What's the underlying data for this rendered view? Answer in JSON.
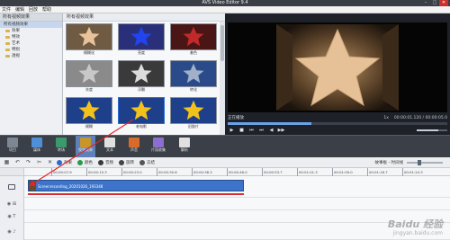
{
  "app": {
    "title": "AVS Video Editor 9.4",
    "window_controls": [
      "–",
      "□",
      "✕"
    ]
  },
  "menu": [
    "文件",
    "编辑",
    "回放",
    "帮助"
  ],
  "sidebar": {
    "header": "所有视频效果",
    "items": [
      {
        "label": "所有视频效果",
        "selected": true
      },
      {
        "label": "效果",
        "selected": false
      },
      {
        "label": "特效",
        "selected": false
      },
      {
        "label": "艺术",
        "selected": false
      },
      {
        "label": "特别",
        "selected": false
      },
      {
        "label": "透视",
        "selected": false
      }
    ]
  },
  "gallery": {
    "header": "所有视频效果",
    "items": [
      {
        "label": "模糊化",
        "bg": "#6f5a44",
        "star": "#e8c39a"
      },
      {
        "label": "亮度",
        "bg": "#2a2f7a",
        "star": "#2244ee"
      },
      {
        "label": "着色",
        "bg": "#4a1515",
        "star": "#c02a2a"
      },
      {
        "label": "灰度",
        "bg": "#8a8a8a",
        "star": "#c8c8c8"
      },
      {
        "label": "浮雕",
        "bg": "#3a3a3a",
        "star": "#dcdcdc"
      },
      {
        "label": "转化",
        "bg": "#2a4a8a",
        "star": "#9fb0c8"
      },
      {
        "label": "模糊",
        "bg": "#1e3f8a",
        "star": "#f3c21a"
      },
      {
        "label": "老电影",
        "bg": "#1e3f8a",
        "star": "#f3c21a"
      },
      {
        "label": "旧胶片",
        "bg": "#1e3f8a",
        "star": "#f3c21a"
      }
    ],
    "selected_index": 7
  },
  "preview": {
    "state": "正在播放",
    "time": "00:00:01.120 / 00:00:05.0",
    "ratio": "1x",
    "progress": 0.38,
    "volume": 0.7,
    "controls": [
      "▶",
      "■",
      "⏮",
      "⏭",
      "◀",
      "▶▶"
    ]
  },
  "toolbar": {
    "items": [
      {
        "label": "项目",
        "color": "#7d8794",
        "active": false
      },
      {
        "label": "媒体",
        "color": "#4f8fd8",
        "active": false
      },
      {
        "label": "转场",
        "color": "#3b9a6b",
        "active": false
      },
      {
        "label": "视频效果",
        "color": "#c7962a",
        "active": true
      },
      {
        "label": "文本",
        "color": "#e0e0e0",
        "active": false
      },
      {
        "label": "声音",
        "color": "#d86a2a",
        "active": false
      },
      {
        "label": "片段收集",
        "color": "#8b6fd0",
        "active": false
      },
      {
        "label": "解析",
        "color": "#e0e0e0",
        "active": false
      }
    ]
  },
  "timeline": {
    "buttons": [
      {
        "label": "效果",
        "color": "#2a6bd0"
      },
      {
        "label": "颜色",
        "color": "#2a9a4a"
      },
      {
        "label": "音频",
        "color": "#3a3a3a"
      },
      {
        "label": "旋转",
        "color": "#444444"
      },
      {
        "label": "冻结",
        "color": "#555555"
      }
    ],
    "storyboard_label": "故事板 - 时间线",
    "ruler": [
      "00:00:07.9",
      "00:00:15.3",
      "00:00:23.0",
      "00:00:30.6",
      "00:00:38.3",
      "00:00:46.0",
      "00:00:53.7",
      "00:01:01.3",
      "00:01:09.0",
      "00:01:16.7",
      "00:01:24.3"
    ],
    "clip_label": "Screenrecording_20201026_193348",
    "clip_color": "#3d74c9",
    "effect_line_color": "#d43030"
  },
  "watermark": {
    "logo": "Baidu 经验",
    "url": "jingyan.baidu.com"
  }
}
